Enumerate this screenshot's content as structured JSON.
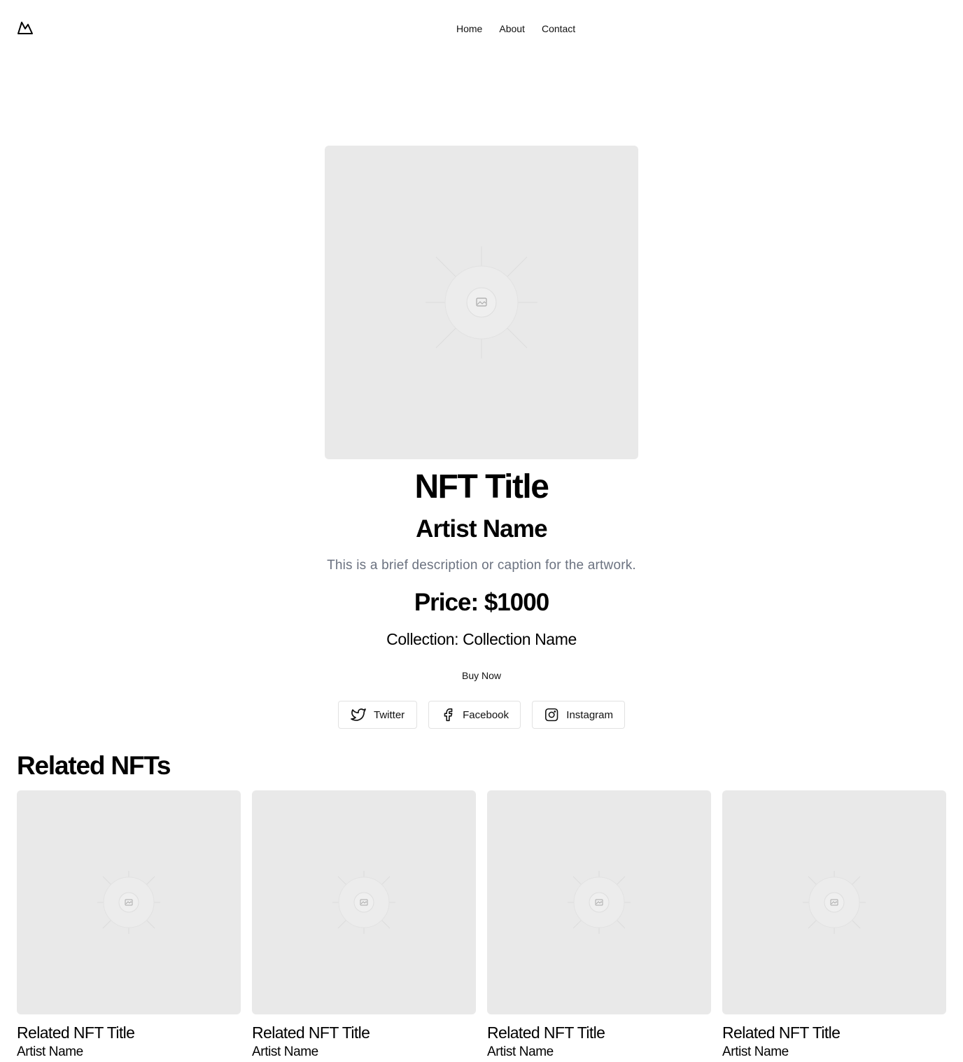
{
  "header": {
    "logo_icon": "mountain-logo-icon",
    "nav": [
      {
        "label": "Home"
      },
      {
        "label": "About"
      },
      {
        "label": "Contact"
      }
    ]
  },
  "nft": {
    "image_icon": "image-placeholder-icon",
    "title": "NFT Title",
    "artist": "Artist Name",
    "description": "This is a brief description or caption for the artwork.",
    "price": "Price: $1000",
    "collection": "Collection: Collection Name",
    "buy_label": "Buy Now"
  },
  "social": [
    {
      "label": "Twitter",
      "icon": "twitter-icon"
    },
    {
      "label": "Facebook",
      "icon": "facebook-icon"
    },
    {
      "label": "Instagram",
      "icon": "instagram-icon"
    }
  ],
  "related": {
    "heading": "Related NFTs",
    "items": [
      {
        "title": "Related NFT Title",
        "artist": "Artist Name"
      },
      {
        "title": "Related NFT Title",
        "artist": "Artist Name"
      },
      {
        "title": "Related NFT Title",
        "artist": "Artist Name"
      },
      {
        "title": "Related NFT Title",
        "artist": "Artist Name"
      }
    ]
  },
  "colors": {
    "placeholder_bg": "#e9e9e9",
    "description_text": "#6b7280",
    "button_border": "#e2e2e2"
  }
}
